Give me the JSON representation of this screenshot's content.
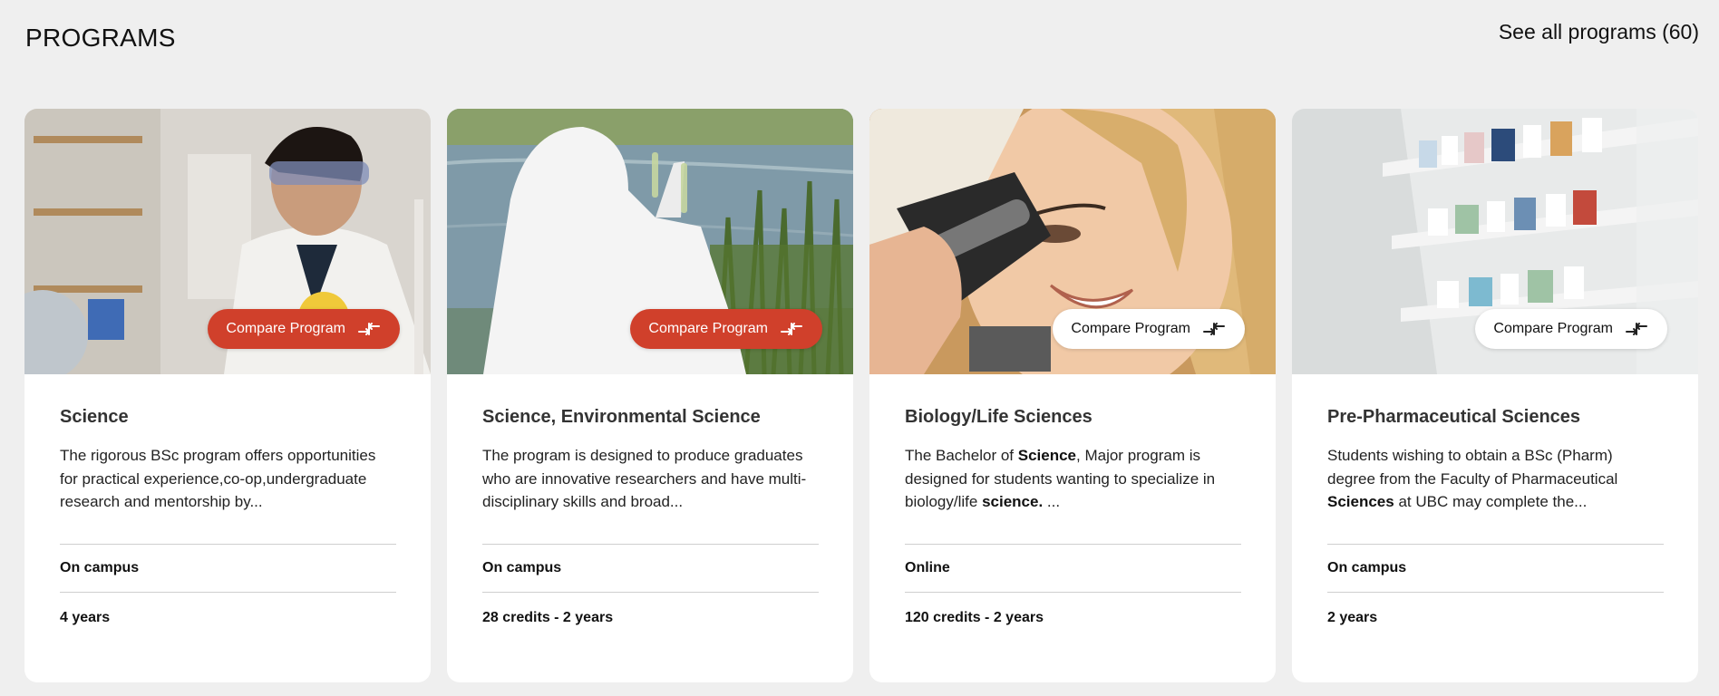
{
  "header": {
    "title": "PROGRAMS",
    "see_all": "See all programs (60)"
  },
  "colors": {
    "accent": "#d0402b",
    "background": "#efefef",
    "card": "#ffffff"
  },
  "cards": [
    {
      "image_alt": "Student in lab coat and safety goggles",
      "compare_label": "Compare Program",
      "compare_selected": true,
      "title": "Science",
      "desc_parts": [
        "The rigorous BSc program offers opportunities for practical experience,co-op,undergraduate research and mentorship by..."
      ],
      "delivery": "On campus",
      "duration": "4 years"
    },
    {
      "image_alt": "Researcher in white suit holding test tubes by a pond",
      "compare_label": "Compare Program",
      "compare_selected": true,
      "title": "Science, Environmental Science",
      "desc_parts": [
        "The program is designed to produce graduates who are innovative researchers and have multi-disciplinary skills and broad..."
      ],
      "delivery": "On campus",
      "duration": "28 credits - 2 years"
    },
    {
      "image_alt": "Smiling student looking through a microscope",
      "compare_label": "Compare Program",
      "compare_selected": false,
      "title": "Biology/Life Sciences",
      "desc_parts": [
        "The Bachelor of ",
        "Science",
        ", Major program is designed for students wanting to specialize in biology/life ",
        "science.",
        " ..."
      ],
      "delivery": "Online",
      "duration": "120 credits - 2 years"
    },
    {
      "image_alt": "Pharmacy shelves stocked with medicine",
      "compare_label": "Compare Program",
      "compare_selected": false,
      "title": "Pre-Pharmaceutical Sciences",
      "desc_parts": [
        "Students wishing to obtain a BSc (Pharm) degree from the Faculty of Pharmaceutical ",
        "Sciences",
        " at UBC may complete the..."
      ],
      "delivery": "On campus",
      "duration": "2 years"
    }
  ]
}
